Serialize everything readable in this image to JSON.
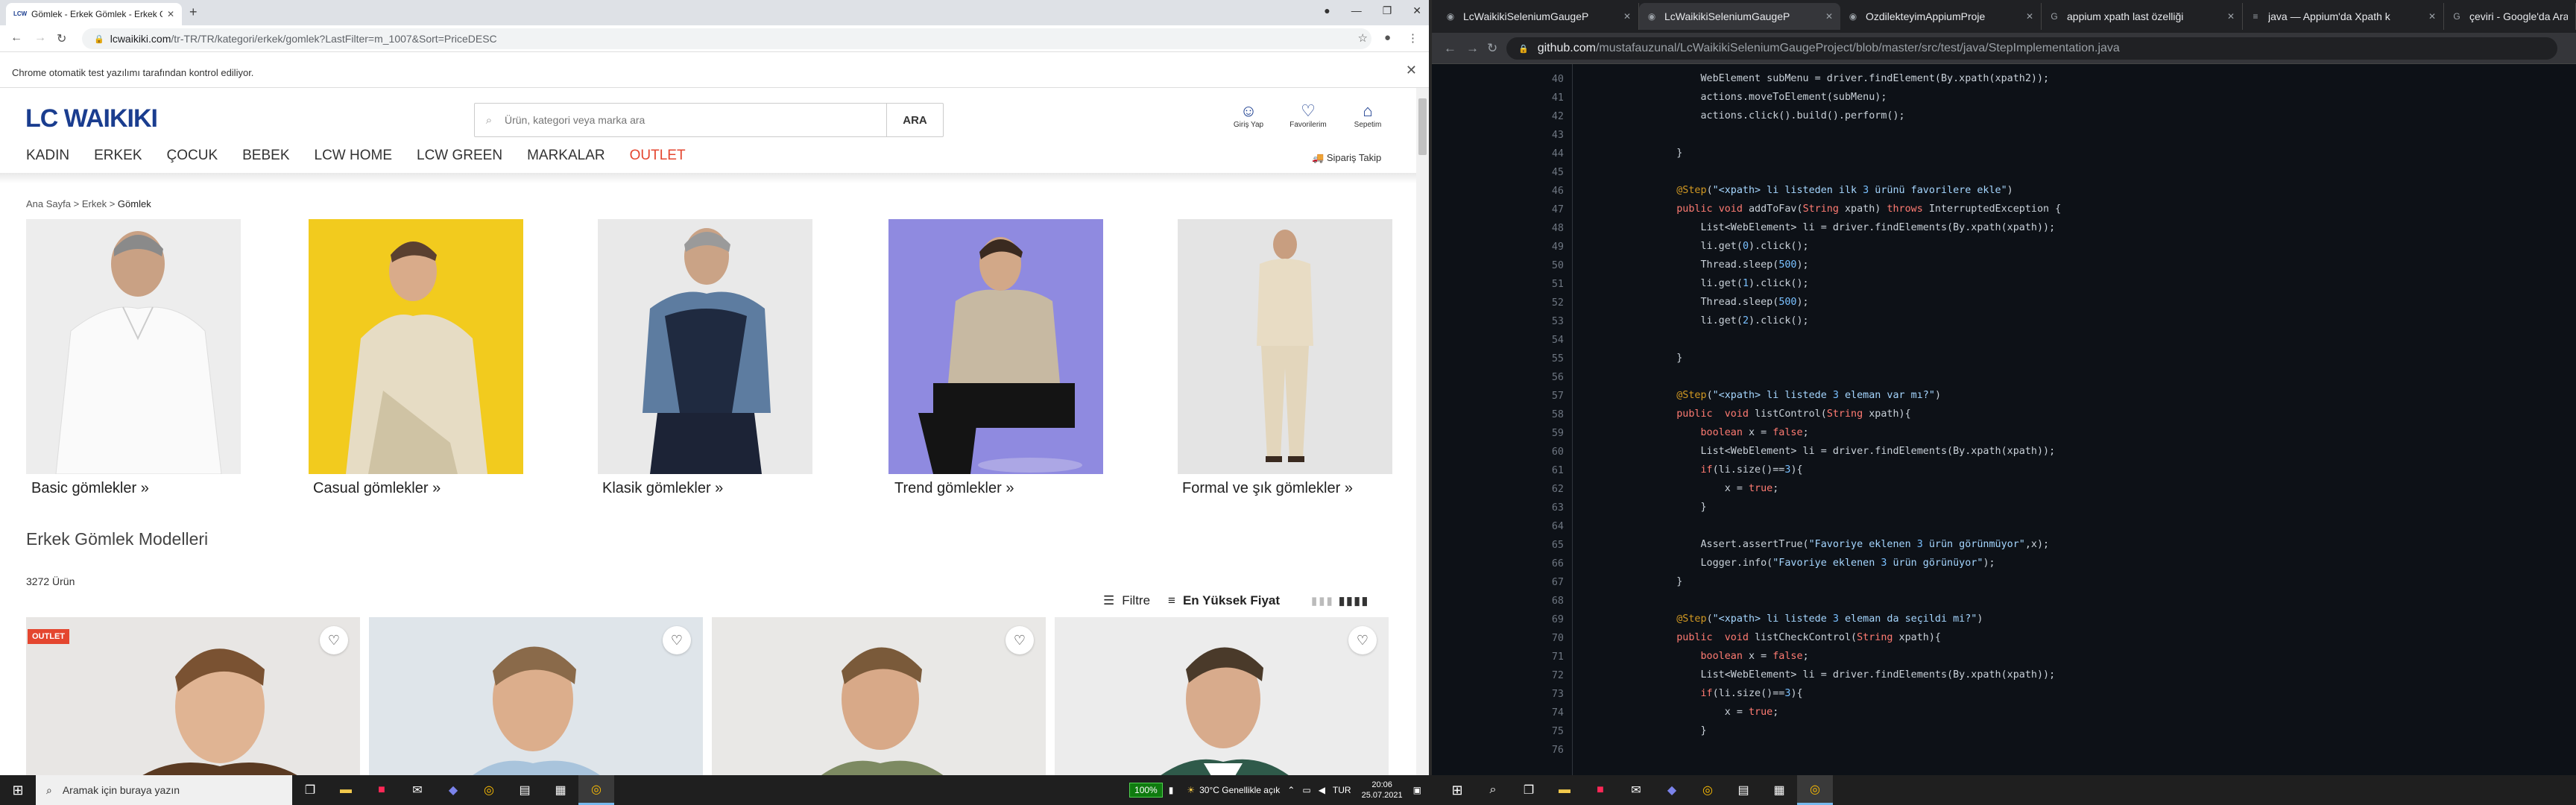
{
  "left": {
    "tab": {
      "title": "Gömlek - Erkek Gömlek - Erkek G",
      "favicon": "LCW"
    },
    "url": {
      "host": "lcwaikiki.com",
      "path": "/tr-TR/TR/kategori/erkek/gomlek?LastFilter=m_1007&Sort=PriceDESC"
    },
    "infobar": "Chrome otomatik test yazılımı tarafından kontrol ediliyor.",
    "logo": "LC WAIKIKI",
    "search": {
      "placeholder": "Ürün, kategori veya marka ara",
      "button": "ARA"
    },
    "user": {
      "login": "Giriş Yap",
      "favorites": "Favorilerim",
      "cart": "Sepetim"
    },
    "categories": [
      "KADIN",
      "ERKEK",
      "ÇOCUK",
      "BEBEK",
      "LCW HOME",
      "LCW GREEN",
      "MARKALAR",
      "OUTLET"
    ],
    "order_track": "Sipariş Takip",
    "breadcrumb": {
      "home": "Ana Sayfa",
      "sep1": ">",
      "men": "Erkek",
      "sep2": ">",
      "current": "Gömlek"
    },
    "subcategories": [
      {
        "label": "Basic gömlekler »"
      },
      {
        "label": "Casual gömlekler »"
      },
      {
        "label": "Klasik gömlekler »"
      },
      {
        "label": "Trend gömlekler »"
      },
      {
        "label": "Formal ve şık gömlekler »"
      }
    ],
    "section_title": "Erkek Gömlek Modelleri",
    "product_count": "3272 Ürün",
    "filter_label": "Filtre",
    "sort_label": "En Yüksek Fiyat",
    "outlet_badge": "OUTLET"
  },
  "right": {
    "tabs": [
      {
        "title": "LcWaikikiSeleniumGaugeP",
        "active": false
      },
      {
        "title": "LcWaikikiSeleniumGaugeP",
        "active": true
      },
      {
        "title": "OzdilekteyimAppiumProje",
        "active": false
      },
      {
        "title": "appium xpath last özelliği",
        "active": false
      },
      {
        "title": "java — Appium'da Xpath k",
        "active": false
      },
      {
        "title": "çeviri - Google'da Ara",
        "active": false
      }
    ],
    "url": {
      "host": "github.com",
      "path": "/mustafauzunal/LcWaikikiSeleniumGaugeProject/blob/master/src/test/java/StepImplementation.java"
    },
    "code_lines": [
      {
        "n": "40",
        "code": "        WebElement subMenu = driver.findElement(By.xpath(xpath2));"
      },
      {
        "n": "41",
        "code": "        actions.moveToElement(subMenu);"
      },
      {
        "n": "42",
        "code": "        actions.click().build().perform();"
      },
      {
        "n": "43",
        "code": ""
      },
      {
        "n": "44",
        "code": "    }"
      },
      {
        "n": "45",
        "code": ""
      },
      {
        "n": "46",
        "code": "    @Step(\"<xpath> li listeden ilk 3 ürünü favorilere ekle\")"
      },
      {
        "n": "47",
        "code": "    public void addToFav(String xpath) throws InterruptedException {"
      },
      {
        "n": "48",
        "code": "        List<WebElement> li = driver.findElements(By.xpath(xpath));"
      },
      {
        "n": "49",
        "code": "        li.get(0).click();"
      },
      {
        "n": "50",
        "code": "        Thread.sleep(500);"
      },
      {
        "n": "51",
        "code": "        li.get(1).click();"
      },
      {
        "n": "52",
        "code": "        Thread.sleep(500);"
      },
      {
        "n": "53",
        "code": "        li.get(2).click();"
      },
      {
        "n": "54",
        "code": ""
      },
      {
        "n": "55",
        "code": "    }"
      },
      {
        "n": "56",
        "code": ""
      },
      {
        "n": "57",
        "code": "    @Step(\"<xpath> li listede 3 eleman var mı?\")"
      },
      {
        "n": "58",
        "code": "    public  void listControl(String xpath){"
      },
      {
        "n": "59",
        "code": "        boolean x = false;"
      },
      {
        "n": "60",
        "code": "        List<WebElement> li = driver.findElements(By.xpath(xpath));"
      },
      {
        "n": "61",
        "code": "        if(li.size()==3){"
      },
      {
        "n": "62",
        "code": "            x = true;"
      },
      {
        "n": "63",
        "code": "        }"
      },
      {
        "n": "64",
        "code": ""
      },
      {
        "n": "65",
        "code": "        Assert.assertTrue(\"Favoriye eklenen 3 ürün görünmüyor\",x);"
      },
      {
        "n": "66",
        "code": "        Logger.info(\"Favoriye eklenen 3 ürün görünüyor\");"
      },
      {
        "n": "67",
        "code": "    }"
      },
      {
        "n": "68",
        "code": ""
      },
      {
        "n": "69",
        "code": "    @Step(\"<xpath> li listede 3 eleman da seçildi mi?\")"
      },
      {
        "n": "70",
        "code": "    public  void listCheckControl(String xpath){"
      },
      {
        "n": "71",
        "code": "        boolean x = false;"
      },
      {
        "n": "72",
        "code": "        List<WebElement> li = driver.findElements(By.xpath(xpath));"
      },
      {
        "n": "73",
        "code": "        if(li.size()==3){"
      },
      {
        "n": "74",
        "code": "            x = true;"
      },
      {
        "n": "75",
        "code": "        }"
      },
      {
        "n": "76",
        "code": ""
      }
    ]
  },
  "taskbar": {
    "search_placeholder": "Aramak için buraya yazın",
    "battery_pct": "100%",
    "weather": "30°C  Genellikle açık",
    "lang": "TUR",
    "time": "20:06",
    "date": "25.07.2021"
  },
  "colors": {
    "brand": "#1a3d8f",
    "outlet": "#e4462f",
    "code_bg": "#0d1117",
    "annotation": "#d29922",
    "keyword": "#ff7b72",
    "string": "#a5d6ff"
  }
}
